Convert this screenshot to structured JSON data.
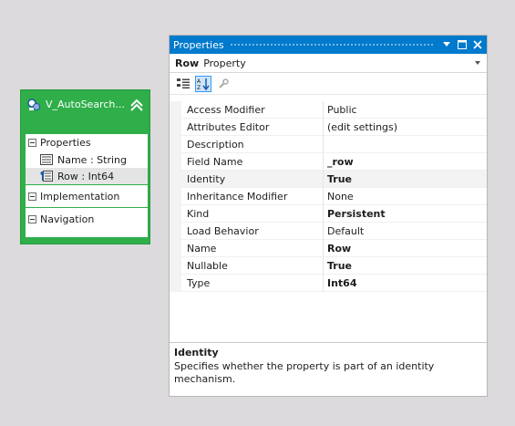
{
  "entity": {
    "title": "V_AutoSearch...",
    "sections": [
      {
        "label": "Properties",
        "members": [
          {
            "label": "Name : String",
            "icon": "property-icon",
            "selected": false
          },
          {
            "label": "Row : Int64",
            "icon": "key-property-icon",
            "selected": true
          }
        ]
      },
      {
        "label": "Implementation"
      },
      {
        "label": "Navigation"
      }
    ]
  },
  "properties_window": {
    "title": "Properties",
    "object_name": "Row",
    "object_type": "Property",
    "rows": [
      {
        "name": "Access Modifier",
        "value": "Public",
        "bold": false
      },
      {
        "name": "Attributes Editor",
        "value": "(edit settings)",
        "bold": false
      },
      {
        "name": "Description",
        "value": "",
        "bold": false
      },
      {
        "name": "Field Name",
        "value": "_row",
        "bold": true
      },
      {
        "name": "Identity",
        "value": "True",
        "bold": true,
        "selected": true
      },
      {
        "name": "Inheritance Modifier",
        "value": "None",
        "bold": false
      },
      {
        "name": "Kind",
        "value": "Persistent",
        "bold": true
      },
      {
        "name": "Load Behavior",
        "value": "Default",
        "bold": false
      },
      {
        "name": "Name",
        "value": "Row",
        "bold": true
      },
      {
        "name": "Nullable",
        "value": "True",
        "bold": true
      },
      {
        "name": "Type",
        "value": "Int64",
        "bold": true
      }
    ],
    "description_title": "Identity",
    "description_text": "Specifies whether the property is part of an identity mechanism."
  },
  "colors": {
    "entity_green": "#2fae4a",
    "titlebar_blue": "#007acc"
  }
}
